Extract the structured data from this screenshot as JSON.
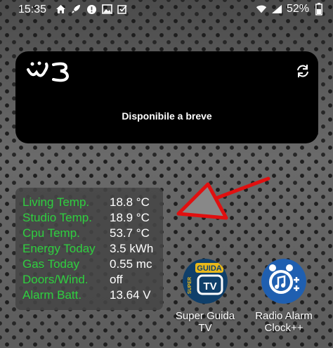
{
  "status_bar": {
    "time": "15:35",
    "battery_percent": "52%"
  },
  "w3_widget": {
    "status_text": "Disponibile a breve"
  },
  "sensors": [
    {
      "label": "Living Temp.",
      "value": "18.8 °C"
    },
    {
      "label": "Studio Temp.",
      "value": "18.9 °C"
    },
    {
      "label": "Cpu Temp.",
      "value": "53.7 °C"
    },
    {
      "label": "Energy Today",
      "value": "3.5 kWh"
    },
    {
      "label": "Gas Today",
      "value": "0.55 mc"
    },
    {
      "label": "Doors/Wind.",
      "value": "off"
    },
    {
      "label": "Alarm Batt.",
      "value": "13.64 V"
    }
  ],
  "apps": {
    "super_guida": {
      "label": "Super Guida TV",
      "icon_word": "GUIDA",
      "icon_vertical": "SUPER",
      "icon_tv": "TV"
    },
    "radio_alarm": {
      "label": "Radio Alarm Clock++"
    }
  },
  "colors": {
    "sensor_label": "#2fcf3f",
    "arrow": "#e01010",
    "radio_icon_bg": "#1f5fb0",
    "guida_icon_bg": "#0f3f6a"
  }
}
